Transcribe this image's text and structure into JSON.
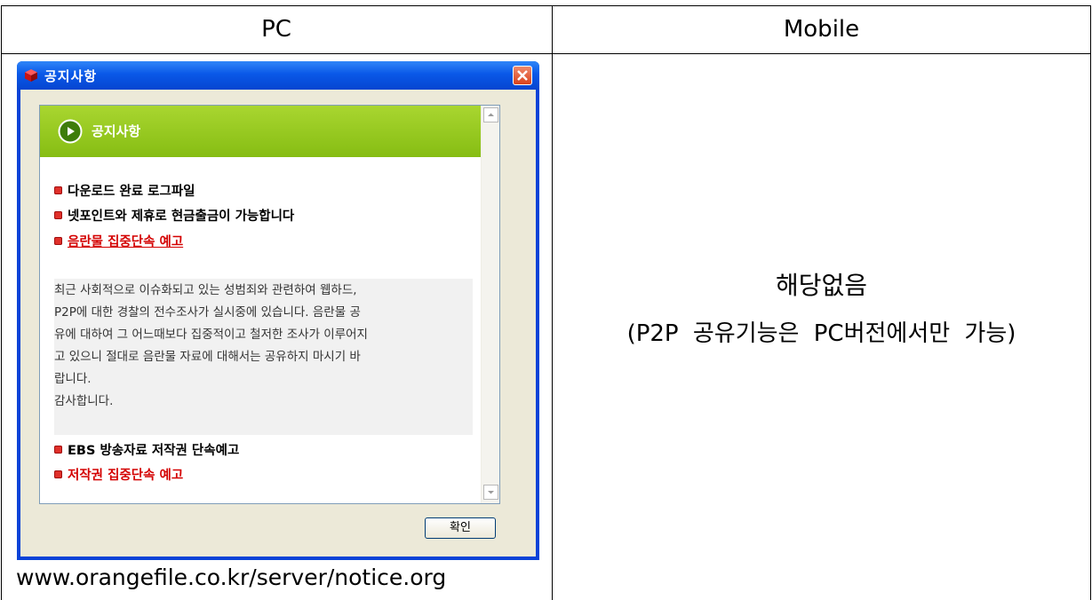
{
  "table": {
    "col_pc": "PC",
    "col_mobile": "Mobile"
  },
  "window": {
    "title": "공지사항",
    "close_icon": "close-icon",
    "panel_title": "공지사항",
    "items": [
      {
        "text": "다운로드 완료 로그파일",
        "color": "#000000"
      },
      {
        "text": "넷포인트와 제휴로 현금출금이 가능합니다",
        "color": "#000000"
      },
      {
        "text": "음란물 집중단속 예고",
        "color": "#d40000"
      },
      {
        "text": "EBS 방송자료 저작권 단속예고",
        "color": "#000000"
      },
      {
        "text": "저작권 집중단속 예고",
        "color": "#d40000"
      }
    ],
    "description": [
      "최근 사회적으로 이슈화되고 있는 성범죄와 관련하여 웹하드,",
      "P2P에 대한 경찰의 전수조사가 실시중에 있습니다. 음란물 공",
      "유에 대하여 그 어느때보다 집중적이고 철저한 조사가 이루어지",
      "고 있으니 절대로 음란물 자료에 대해서는 공유하지 마시기 바",
      "랍니다.",
      "감사합니다."
    ],
    "ok_label": "확인"
  },
  "pc_url": "www.orangefile.co.kr/server/notice.org",
  "mobile": {
    "main": "해당없음",
    "sub": "(P2P 공유기능은 PC버전에서만 가능)"
  }
}
